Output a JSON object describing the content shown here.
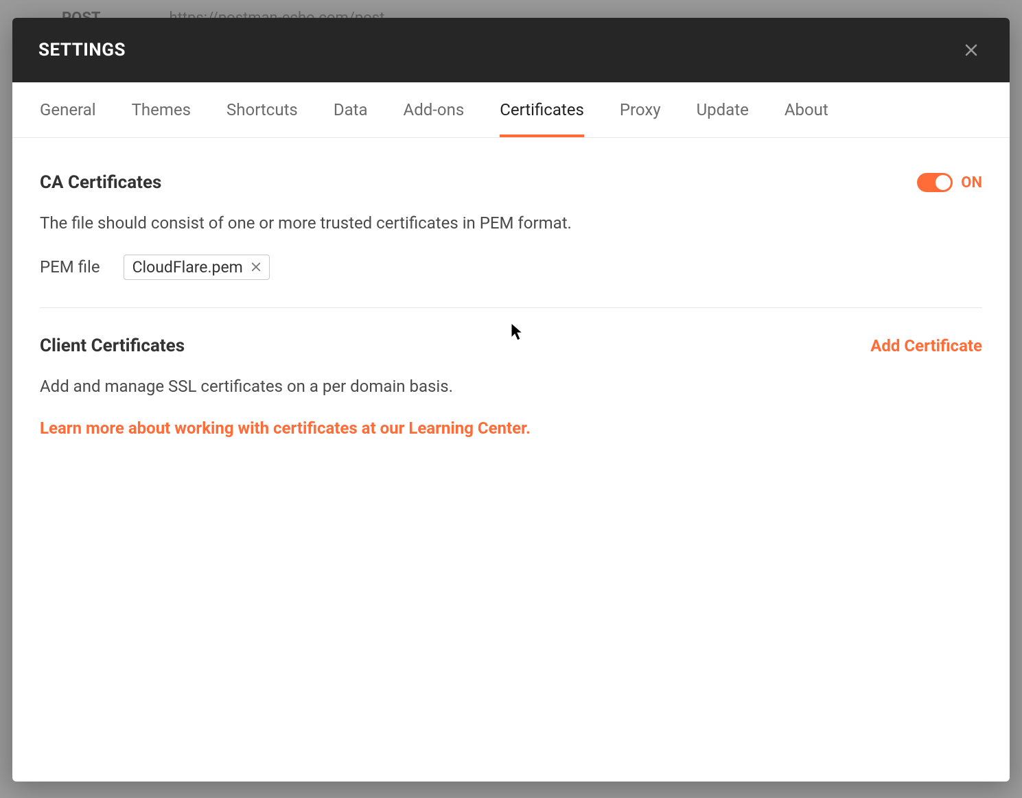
{
  "backdrop": {
    "method": "POST",
    "url": "https://postman-echo.com/post"
  },
  "modal": {
    "title": "SETTINGS"
  },
  "tabs": {
    "general": "General",
    "themes": "Themes",
    "shortcuts": "Shortcuts",
    "data": "Data",
    "addons": "Add-ons",
    "certificates": "Certificates",
    "proxy": "Proxy",
    "update": "Update",
    "about": "About",
    "active": "certificates"
  },
  "ca": {
    "title": "CA Certificates",
    "toggle_state": "ON",
    "description": "The file should consist of one or more trusted certificates in PEM format.",
    "pem_label": "PEM file",
    "pem_filename": "CloudFlare.pem"
  },
  "client": {
    "title": "Client Certificates",
    "add_label": "Add Certificate",
    "description": "Add and manage SSL certificates on a per domain basis.",
    "learn_link": "Learn more about working with certificates at our Learning Center."
  },
  "colors": {
    "accent": "#ff6c37"
  }
}
